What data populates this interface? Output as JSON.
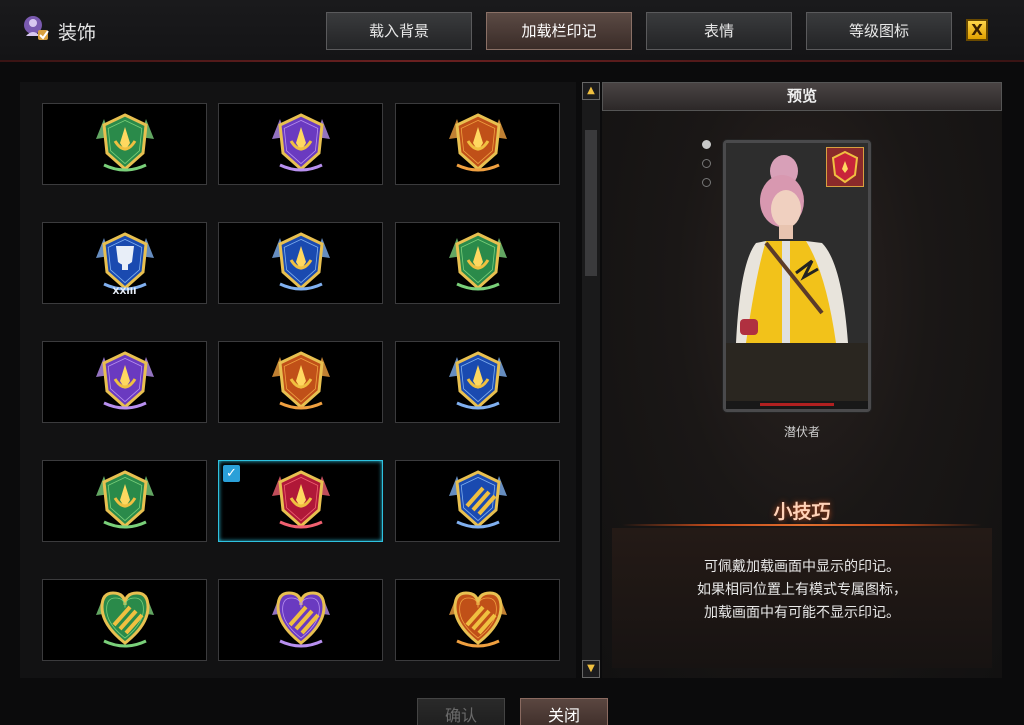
{
  "window": {
    "title": "装饰",
    "close_label": "X"
  },
  "tabs": [
    {
      "label": "载入背景",
      "active": false
    },
    {
      "label": "加载栏印记",
      "active": true
    },
    {
      "label": "表情",
      "active": false
    },
    {
      "label": "等级图标",
      "active": false
    }
  ],
  "grid": {
    "items": [
      {
        "icon": "emblem-green-gold",
        "selected": false
      },
      {
        "icon": "emblem-purple",
        "selected": false
      },
      {
        "icon": "emblem-orange",
        "selected": false
      },
      {
        "icon": "emblem-blue-trophy-xxiii",
        "text": "XXIII",
        "selected": false
      },
      {
        "icon": "emblem-blue-yellow",
        "selected": false
      },
      {
        "icon": "emblem-green",
        "selected": false
      },
      {
        "icon": "emblem-purple-gold",
        "selected": false
      },
      {
        "icon": "emblem-orange-gold",
        "selected": false
      },
      {
        "icon": "emblem-blue-gold",
        "selected": false
      },
      {
        "icon": "emblem-green-winged",
        "selected": false
      },
      {
        "icon": "emblem-red-gold",
        "selected": true
      },
      {
        "icon": "emblem-blue-trident",
        "selected": false
      },
      {
        "icon": "emblem-green-heart-trident",
        "selected": false
      },
      {
        "icon": "emblem-purple-heart-trident",
        "selected": false
      },
      {
        "icon": "emblem-orange-heart-trident",
        "selected": false
      }
    ]
  },
  "preview": {
    "header": "预览",
    "character_name": "潜伏者",
    "page_dots": 3,
    "active_dot": 0
  },
  "tips": {
    "title": "小技巧",
    "lines": [
      "可佩戴加载画面中显示的印记。",
      "如果相同位置上有模式专属图标，",
      "加载画面中有可能不显示印记。"
    ]
  },
  "buttons": {
    "confirm": "确认",
    "close": "关闭"
  },
  "colors": {
    "selected_border": "#2ec2e0",
    "accent_gold": "#f0c040",
    "tips_glow": "#c24a1a"
  }
}
